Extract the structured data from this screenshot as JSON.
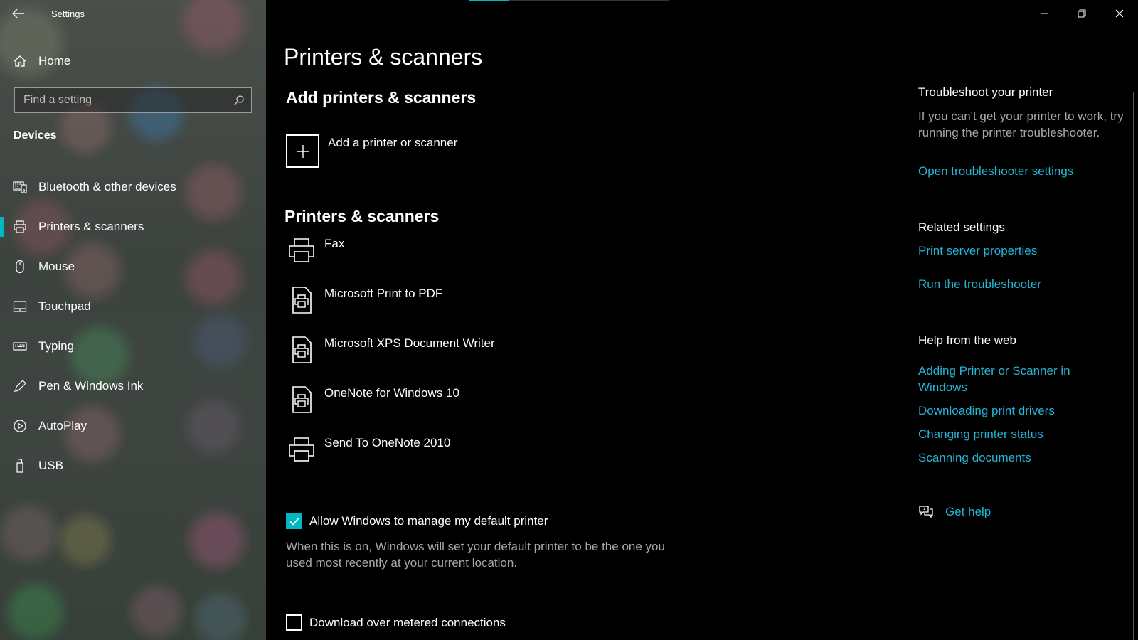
{
  "app": {
    "title": "Settings"
  },
  "sidebar": {
    "home_label": "Home",
    "search_placeholder": "Find a setting",
    "section": "Devices",
    "items": [
      {
        "label": "Bluetooth & other devices",
        "icon": "bluetooth-devices-icon",
        "selected": false
      },
      {
        "label": "Printers & scanners",
        "icon": "printer-icon",
        "selected": true
      },
      {
        "label": "Mouse",
        "icon": "mouse-icon",
        "selected": false
      },
      {
        "label": "Touchpad",
        "icon": "touchpad-icon",
        "selected": false
      },
      {
        "label": "Typing",
        "icon": "keyboard-icon",
        "selected": false
      },
      {
        "label": "Pen & Windows Ink",
        "icon": "pen-icon",
        "selected": false
      },
      {
        "label": "AutoPlay",
        "icon": "autoplay-icon",
        "selected": false
      },
      {
        "label": "USB",
        "icon": "usb-icon",
        "selected": false
      }
    ]
  },
  "main": {
    "page_title": "Printers & scanners",
    "add_section_title": "Add printers & scanners",
    "add_button_label": "Add a printer or scanner",
    "list_section_title": "Printers & scanners",
    "printers": [
      {
        "label": "Fax",
        "icon": "fax-printer-icon"
      },
      {
        "label": "Microsoft Print to PDF",
        "icon": "document-printer-icon"
      },
      {
        "label": "Microsoft XPS Document Writer",
        "icon": "document-printer-icon"
      },
      {
        "label": "OneNote for Windows 10",
        "icon": "document-printer-icon"
      },
      {
        "label": "Send To OneNote 2010",
        "icon": "printer-icon"
      }
    ],
    "default_printer": {
      "label": "Allow Windows to manage my default printer",
      "checked": true,
      "description": "When this is on, Windows will set your default printer to be the one you used most recently at your current location."
    },
    "metered": {
      "label": "Download over metered connections",
      "checked": false
    }
  },
  "right": {
    "troubleshoot_heading": "Troubleshoot your printer",
    "troubleshoot_text": "If you can't get your printer to work, try running the printer troubleshooter.",
    "troubleshoot_link": "Open troubleshooter settings",
    "related_heading": "Related settings",
    "related_links": [
      "Print server properties",
      "Run the troubleshooter"
    ],
    "web_heading": "Help from the web",
    "web_links": [
      "Adding Printer or Scanner in Windows",
      "Downloading print drivers",
      "Changing printer status",
      "Scanning documents"
    ],
    "get_help_label": "Get help"
  },
  "colors": {
    "accent": "#00b7c3",
    "link": "#24b5d6",
    "background": "#000000",
    "secondary_text": "#a8a8a8"
  }
}
